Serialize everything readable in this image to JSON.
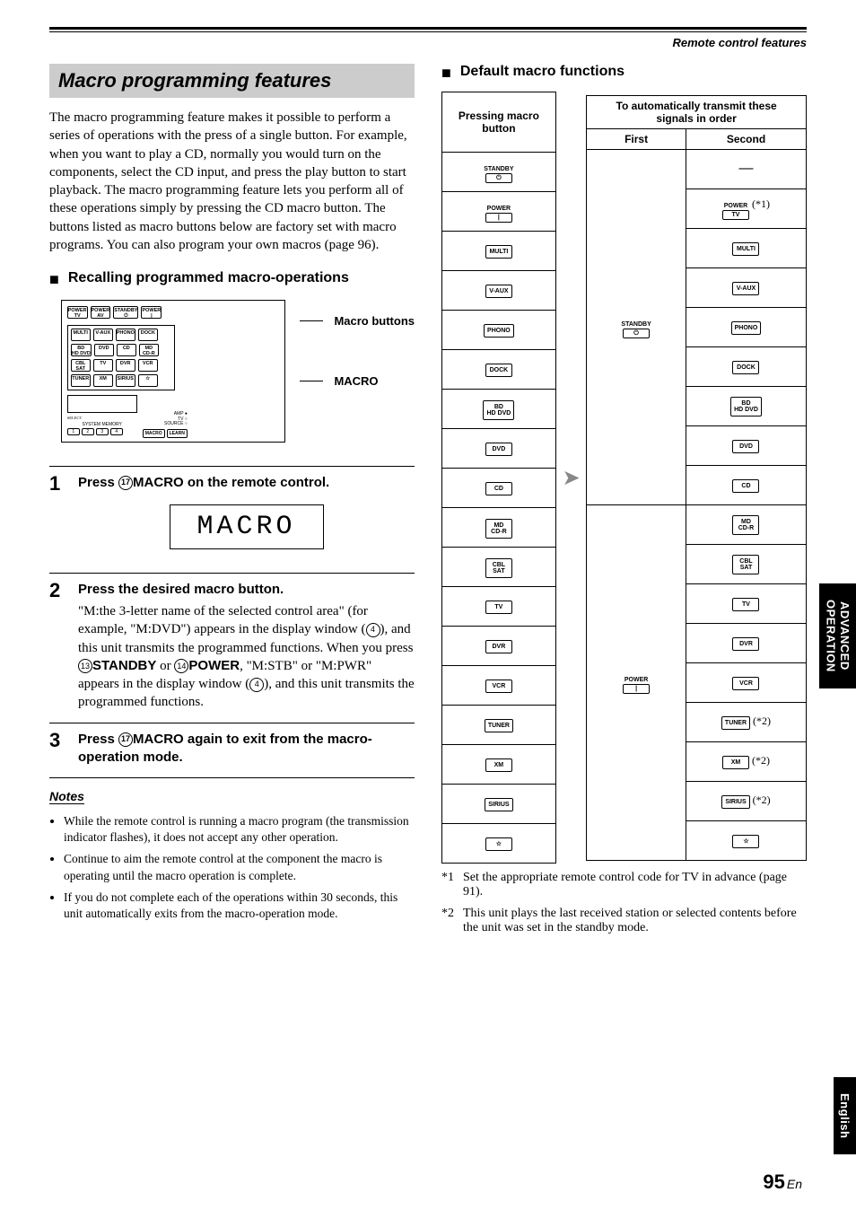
{
  "header": {
    "top_label": "Remote control features"
  },
  "left": {
    "title": "Macro programming features",
    "intro": "The macro programming feature makes it possible to perform a series of operations with the press of a single button. For example, when you want to play a CD, normally you would turn on the components, select the CD input, and press the play button to start playback. The macro programming feature lets you perform all of these operations simply by pressing the CD macro button. The buttons listed as macro buttons below are factory set with macro programs. You can also program your own macros (page 96).",
    "subhead1": "Recalling programmed macro-operations",
    "diagram": {
      "label_buttons": "Macro buttons",
      "label_macro": "MACRO",
      "row1": [
        "POWER\nTV",
        "POWER\nAV",
        "STANDBY\n⏻",
        "POWER\n|"
      ],
      "row2": [
        "MULTI",
        "V-AUX",
        "PHONO",
        "DOCK"
      ],
      "row3": [
        "BD\nHD DVD",
        "DVD",
        "CD",
        "MD\nCD-R"
      ],
      "row4": [
        "CBL\nSAT",
        "TV",
        "DVR",
        "VCR"
      ],
      "row5": [
        "TUNER",
        "XM",
        "SIRIUS",
        "☆"
      ],
      "below_macro": [
        "1",
        "2",
        "3",
        "4"
      ],
      "small_labels": "AMP ●\nTV ○\nSOURCE ○",
      "select_row_label": "SELECT",
      "sysmem_label": "SYSTEM MEMORY"
    },
    "steps": [
      {
        "n": "1",
        "title_prefix": "Press ",
        "title_circ": "⑰",
        "title_macro": "MACRO",
        "title_suffix": " on the remote control.",
        "display": "MACRO"
      },
      {
        "n": "2",
        "title": "Press the desired macro button.",
        "body_a": "\"M:the 3-letter name of the selected control area\" (for example, \"M:DVD\") appears in the display window (",
        "body_circ1": "④",
        "body_b": "), and this unit transmits the programmed functions. When you press ",
        "body_circ2": "⑬",
        "body_bold1": "STANDBY",
        "body_c": " or ",
        "body_circ3": "⑭",
        "body_bold2": "POWER",
        "body_d": ", \"M:STB\" or \"M:PWR\" appears in the display window (",
        "body_circ4": "④",
        "body_e": "), and this unit transmits the programmed functions."
      },
      {
        "n": "3",
        "title_prefix": "Press ",
        "title_circ": "⑰",
        "title_macro": "MACRO",
        "title_suffix": " again to exit from the macro-operation mode."
      }
    ],
    "notes_hdr": "Notes",
    "notes": [
      "While the remote control is running a macro program (the transmission indicator flashes), it does not accept any other operation.",
      "Continue to aim the remote control at the component the macro is operating until the macro operation is complete.",
      "If you do not complete each of the operations within 30 seconds, this unit automatically exits from the macro-operation mode."
    ]
  },
  "right": {
    "subhead": "Default macro functions",
    "pressing_header": "Pressing macro button",
    "transmit_header": "To automatically transmit these signals in order",
    "first": "First",
    "second": "Second",
    "rows": [
      {
        "p": {
          "t": "compound",
          "top": "STANDBY",
          "sym": "⏻"
        },
        "f": {
          "t": "compound",
          "top": "STANDBY",
          "sym": "⏻"
        },
        "s": {
          "t": "dash"
        }
      },
      {
        "p": {
          "t": "compound",
          "top": "POWER",
          "sym": "|"
        },
        "f": null,
        "s": {
          "t": "compound",
          "top": "POWER",
          "sym": "TV",
          "ann": "(*1)"
        }
      },
      {
        "p": {
          "t": "plain",
          "l": "MULTI"
        },
        "f": null,
        "s": {
          "t": "plain",
          "l": "MULTI"
        }
      },
      {
        "p": {
          "t": "plain",
          "l": "V-AUX"
        },
        "f": null,
        "s": {
          "t": "plain",
          "l": "V-AUX"
        }
      },
      {
        "p": {
          "t": "plain",
          "l": "PHONO"
        },
        "f": null,
        "s": {
          "t": "plain",
          "l": "PHONO"
        }
      },
      {
        "p": {
          "t": "plain",
          "l": "DOCK"
        },
        "f": null,
        "s": {
          "t": "plain",
          "l": "DOCK"
        }
      },
      {
        "p": {
          "t": "two",
          "l1": "BD",
          "l2": "HD DVD"
        },
        "f": null,
        "s": {
          "t": "two",
          "l1": "BD",
          "l2": "HD DVD"
        }
      },
      {
        "p": {
          "t": "plain",
          "l": "DVD"
        },
        "f": null,
        "s": {
          "t": "plain",
          "l": "DVD"
        }
      },
      {
        "p": {
          "t": "plain",
          "l": "CD"
        },
        "f": null,
        "s": {
          "t": "plain",
          "l": "CD"
        }
      },
      {
        "p": {
          "t": "two",
          "l1": "MD",
          "l2": "CD-R"
        },
        "f": {
          "t": "compound",
          "top": "POWER",
          "sym": "|"
        },
        "s": {
          "t": "two",
          "l1": "MD",
          "l2": "CD-R"
        }
      },
      {
        "p": {
          "t": "two",
          "l1": "CBL",
          "l2": "SAT"
        },
        "f": null,
        "s": {
          "t": "two",
          "l1": "CBL",
          "l2": "SAT"
        }
      },
      {
        "p": {
          "t": "plain",
          "l": "TV"
        },
        "f": null,
        "s": {
          "t": "plain",
          "l": "TV"
        }
      },
      {
        "p": {
          "t": "plain",
          "l": "DVR"
        },
        "f": null,
        "s": {
          "t": "plain",
          "l": "DVR"
        }
      },
      {
        "p": {
          "t": "plain",
          "l": "VCR"
        },
        "f": null,
        "s": {
          "t": "plain",
          "l": "VCR"
        }
      },
      {
        "p": {
          "t": "plain",
          "l": "TUNER"
        },
        "f": null,
        "s": {
          "t": "plain",
          "l": "TUNER",
          "ann": "(*2)"
        }
      },
      {
        "p": {
          "t": "plain",
          "l": "XM"
        },
        "f": null,
        "s": {
          "t": "plain",
          "l": "XM",
          "ann": "(*2)"
        }
      },
      {
        "p": {
          "t": "plain",
          "l": "SIRIUS"
        },
        "f": null,
        "s": {
          "t": "plain",
          "l": "SIRIUS",
          "ann": "(*2)"
        }
      },
      {
        "p": {
          "t": "plain",
          "l": "☆"
        },
        "f": null,
        "s": {
          "t": "plain",
          "l": "☆"
        }
      }
    ],
    "footnotes": [
      {
        "mark": "*1",
        "text": "Set the appropriate remote control code for TV in advance (page 91)."
      },
      {
        "mark": "*2",
        "text": "This unit plays the last received station or selected contents before the unit was set in the standby mode."
      }
    ]
  },
  "side": {
    "adv1": "ADVANCED",
    "adv2": "OPERATION",
    "eng": "English"
  },
  "page": {
    "num": "95",
    "suffix": "En"
  }
}
